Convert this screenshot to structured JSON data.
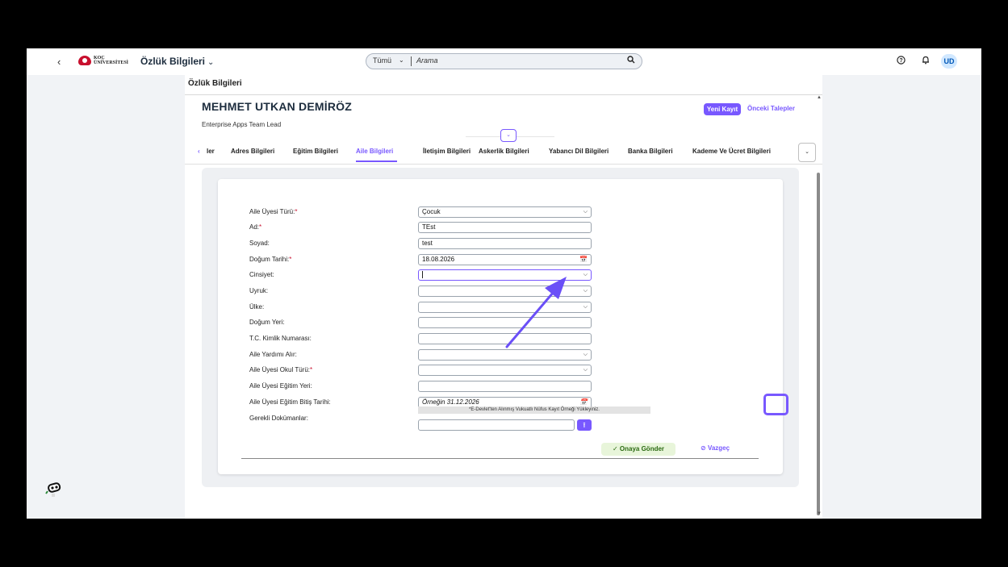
{
  "shellbar": {
    "back": "‹",
    "logo_text_1": "KOÇ",
    "logo_text_2": "ÜNİVERSİTESİ",
    "app_title": "Özlük Bilgileri",
    "app_title_chevron": "⌄",
    "search_scope": "Tümü",
    "search_scope_chevron": "⌄",
    "search_placeholder": "Arama",
    "help_icon": "?",
    "bell_icon": "🔔",
    "avatar": "UD"
  },
  "page": {
    "header": "Özlük Bilgileri",
    "employee_name": "MEHMET UTKAN DEMİRÖZ",
    "employee_title": "Enterprise Apps Team Lead",
    "new_record": "Yeni Kayıt",
    "previous_requests": "Önceki Talepler",
    "collapse": "⌄"
  },
  "tabs": {
    "prev": "‹",
    "partial": "ler",
    "items": [
      {
        "label": "Adres Bilgileri"
      },
      {
        "label": "Eğitim Bilgileri"
      },
      {
        "label": "Aile Bilgileri"
      },
      {
        "label": "İletişim Bilgileri"
      },
      {
        "label": "Askerlik Bilgileri"
      },
      {
        "label": "Yabancı Dil Bilgileri"
      },
      {
        "label": "Banka Bilgileri"
      },
      {
        "label": "Kademe Ve Ücret Bilgileri"
      }
    ],
    "active_index": 2,
    "more": "⌄"
  },
  "form": {
    "fields": [
      {
        "label": "Aile Üyesi Türü:",
        "required": true,
        "value": "Çocuk",
        "type": "select"
      },
      {
        "label": "Ad:",
        "required": true,
        "value": "TEst",
        "type": "text"
      },
      {
        "label": "Soyad:",
        "required": false,
        "value": "test",
        "type": "text"
      },
      {
        "label": "Doğum Tarihi:",
        "required": true,
        "value": "18.08.2026",
        "type": "date"
      },
      {
        "label": "Cinsiyet:",
        "required": false,
        "value": "",
        "type": "select",
        "focused": true
      },
      {
        "label": "Uyruk:",
        "required": false,
        "value": "",
        "type": "select"
      },
      {
        "label": "Ülke:",
        "required": false,
        "value": "",
        "type": "select"
      },
      {
        "label": "Doğum Yeri:",
        "required": false,
        "value": "",
        "type": "text"
      },
      {
        "label": "T.C. Kimlik Numarası:",
        "required": false,
        "value": "",
        "type": "text"
      },
      {
        "label": "Aile Yardımı Alır:",
        "required": false,
        "value": "",
        "type": "select"
      },
      {
        "label": "Aile Üyesi Okul Türü:",
        "required": true,
        "value": "",
        "type": "select"
      },
      {
        "label": "Aile Üyesi Eğitim Yeri:",
        "required": false,
        "value": "",
        "type": "text"
      },
      {
        "label": "Aile Üyesi Eğitim Bitiş Tarihi:",
        "required": false,
        "value": "",
        "placeholder": "Örneğin 31.12.2026",
        "type": "date"
      }
    ],
    "documents_label": "Gerekli Dokümanlar:",
    "documents_hint": "*E-Devlet'ten Alınmış Vukuatlı Nüfus Kayıt Örneği Yükleyiniz.",
    "upload_icon": "⭱",
    "submit": "Onaya Gönder",
    "submit_icon": "✓",
    "cancel": "Vazgeç",
    "cancel_icon": "⊘"
  },
  "colors": {
    "accent": "#7858ff",
    "required": "#c8102e",
    "submit_bg": "#e8f5da"
  }
}
